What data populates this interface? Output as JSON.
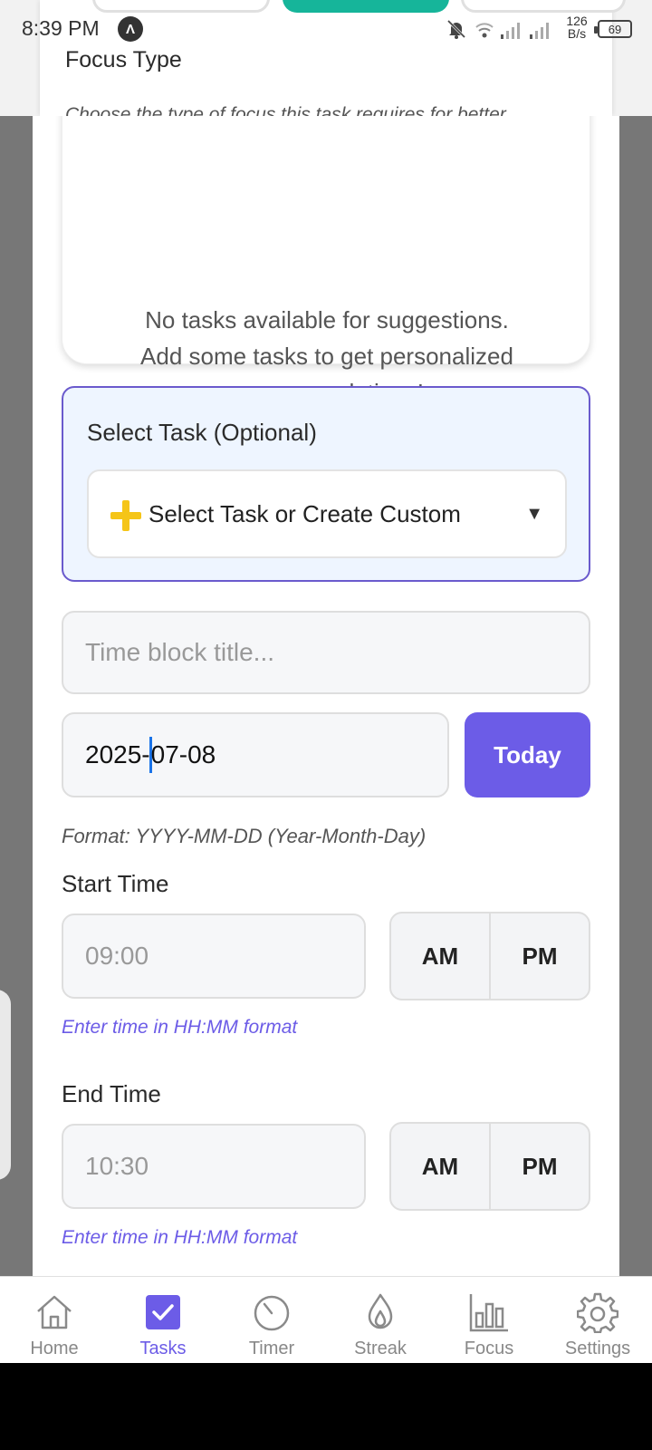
{
  "status_bar": {
    "time": "8:39 PM",
    "app_indicator": "Λ",
    "net_speed_value": "126",
    "net_speed_unit": "B/s",
    "battery": "69",
    "icons": [
      "bell-off-icon",
      "wifi-icon",
      "signal-icon",
      "signal-icon"
    ]
  },
  "background_form": {
    "heading": "Focus Type",
    "description": "Choose the type of focus this task requires for better"
  },
  "suggestions": {
    "line1": "No tasks available for suggestions.",
    "line2": "Add some tasks to get personalized",
    "line3": "recommendations!"
  },
  "select_task": {
    "label": "Select Task (Optional)",
    "dropdown_value": "Select Task or Create Custom",
    "dropdown_icon": "plus-icon",
    "caret": "▼"
  },
  "title_input": {
    "placeholder": "Time block title..."
  },
  "date": {
    "value_before_cursor": "2025-",
    "value_after_cursor": "07-08",
    "today_label": "Today",
    "format_hint": "Format: YYYY-MM-DD (Year-Month-Day)"
  },
  "start_time": {
    "label": "Start Time",
    "placeholder": "09:00",
    "am": "AM",
    "pm": "PM",
    "hint": "Enter time in HH:MM format"
  },
  "end_time": {
    "label": "End Time",
    "placeholder": "10:30",
    "am": "AM",
    "pm": "PM",
    "hint": "Enter time in HH:MM format"
  },
  "nav": {
    "active": "Tasks",
    "accent": "#6c5ce7",
    "items": [
      {
        "label": "Home",
        "icon": "home-icon"
      },
      {
        "label": "Tasks",
        "icon": "checkbox-icon"
      },
      {
        "label": "Timer",
        "icon": "timer-icon"
      },
      {
        "label": "Streak",
        "icon": "flame-icon"
      },
      {
        "label": "Focus",
        "icon": "bar-chart-icon"
      },
      {
        "label": "Settings",
        "icon": "gear-icon"
      }
    ]
  }
}
